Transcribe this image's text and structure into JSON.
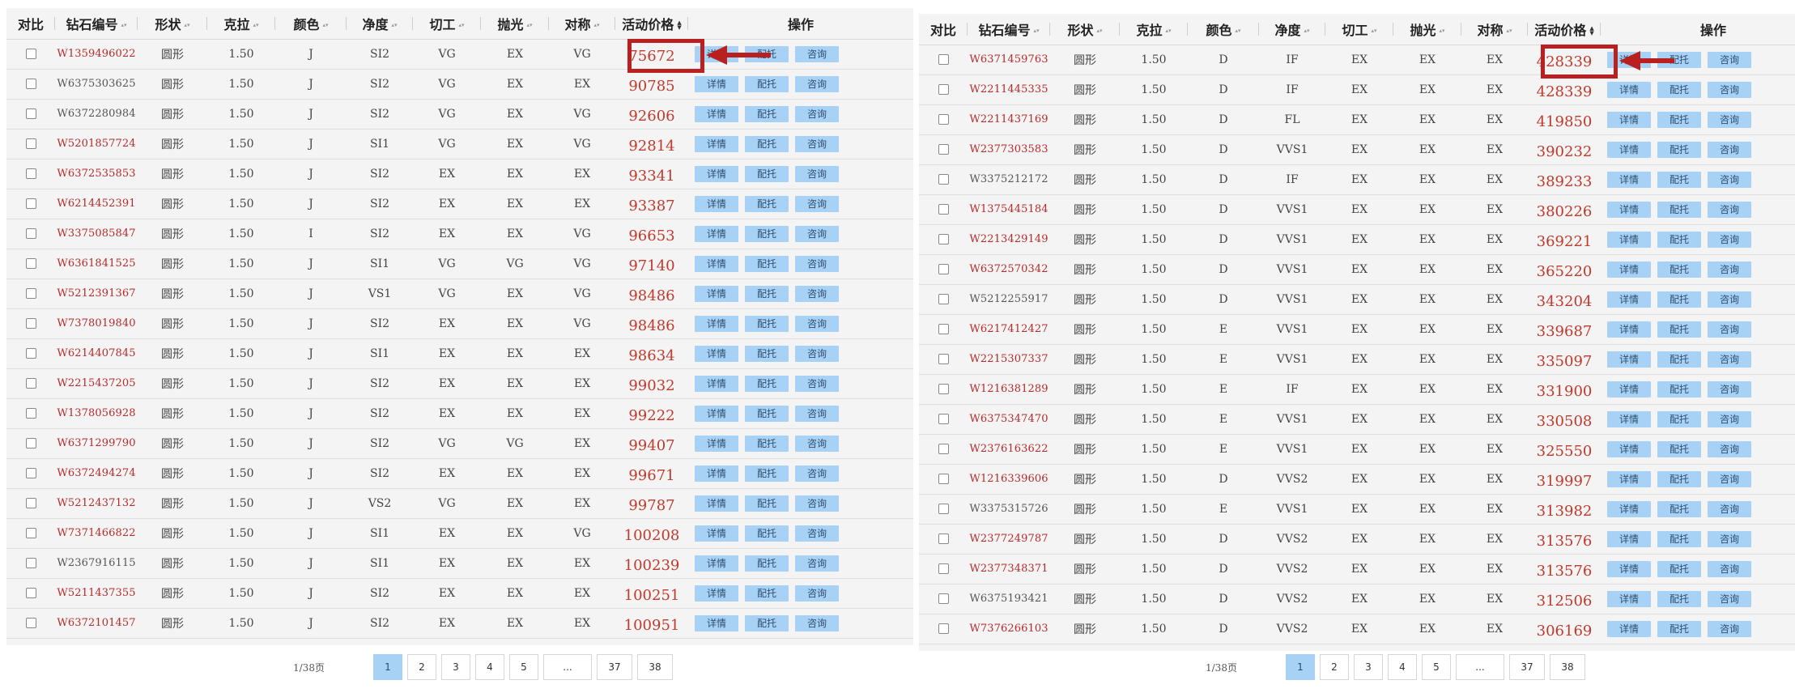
{
  "colors": {
    "price": "#c0392b",
    "id_red": "#b52a2a",
    "button_bg": "#a7d1f5",
    "highlight": "#b8211f"
  },
  "table": {
    "headers": {
      "compare": "对比",
      "id": "钻石编号",
      "shape": "形状",
      "carat": "克拉",
      "color": "颜色",
      "clarity": "净度",
      "cut": "切工",
      "polish": "抛光",
      "symmetry": "对称",
      "price": "活动价格",
      "ops": "操作"
    },
    "buttons": {
      "details": "详情",
      "setting": "配托",
      "consult": "咨询"
    }
  },
  "left": {
    "rows": [
      {
        "id": "W1359496022",
        "red": true,
        "shape": "圆形",
        "carat": "1.50",
        "color": "J",
        "clarity": "SI2",
        "cut": "VG",
        "polish": "EX",
        "sym": "VG",
        "price": "75672"
      },
      {
        "id": "W6375303625",
        "red": false,
        "shape": "圆形",
        "carat": "1.50",
        "color": "J",
        "clarity": "SI2",
        "cut": "VG",
        "polish": "EX",
        "sym": "EX",
        "price": "90785"
      },
      {
        "id": "W6372280984",
        "red": false,
        "shape": "圆形",
        "carat": "1.50",
        "color": "J",
        "clarity": "SI2",
        "cut": "VG",
        "polish": "EX",
        "sym": "VG",
        "price": "92606"
      },
      {
        "id": "W5201857724",
        "red": true,
        "shape": "圆形",
        "carat": "1.50",
        "color": "J",
        "clarity": "SI1",
        "cut": "VG",
        "polish": "EX",
        "sym": "VG",
        "price": "92814"
      },
      {
        "id": "W6372535853",
        "red": true,
        "shape": "圆形",
        "carat": "1.50",
        "color": "J",
        "clarity": "SI2",
        "cut": "EX",
        "polish": "EX",
        "sym": "EX",
        "price": "93341"
      },
      {
        "id": "W6214452391",
        "red": true,
        "shape": "圆形",
        "carat": "1.50",
        "color": "J",
        "clarity": "SI2",
        "cut": "EX",
        "polish": "EX",
        "sym": "EX",
        "price": "93387"
      },
      {
        "id": "W3375085847",
        "red": true,
        "shape": "圆形",
        "carat": "1.50",
        "color": "I",
        "clarity": "SI2",
        "cut": "EX",
        "polish": "EX",
        "sym": "VG",
        "price": "96653"
      },
      {
        "id": "W6361841525",
        "red": true,
        "shape": "圆形",
        "carat": "1.50",
        "color": "J",
        "clarity": "SI1",
        "cut": "VG",
        "polish": "VG",
        "sym": "VG",
        "price": "97140"
      },
      {
        "id": "W5212391367",
        "red": true,
        "shape": "圆形",
        "carat": "1.50",
        "color": "J",
        "clarity": "VS1",
        "cut": "VG",
        "polish": "EX",
        "sym": "VG",
        "price": "98486"
      },
      {
        "id": "W7378019840",
        "red": true,
        "shape": "圆形",
        "carat": "1.50",
        "color": "J",
        "clarity": "SI2",
        "cut": "EX",
        "polish": "EX",
        "sym": "VG",
        "price": "98486"
      },
      {
        "id": "W6214407845",
        "red": true,
        "shape": "圆形",
        "carat": "1.50",
        "color": "J",
        "clarity": "SI1",
        "cut": "EX",
        "polish": "EX",
        "sym": "EX",
        "price": "98634"
      },
      {
        "id": "W2215437205",
        "red": true,
        "shape": "圆形",
        "carat": "1.50",
        "color": "J",
        "clarity": "SI2",
        "cut": "EX",
        "polish": "EX",
        "sym": "EX",
        "price": "99032"
      },
      {
        "id": "W1378056928",
        "red": true,
        "shape": "圆形",
        "carat": "1.50",
        "color": "J",
        "clarity": "SI2",
        "cut": "EX",
        "polish": "EX",
        "sym": "EX",
        "price": "99222"
      },
      {
        "id": "W6371299790",
        "red": true,
        "shape": "圆形",
        "carat": "1.50",
        "color": "J",
        "clarity": "SI2",
        "cut": "VG",
        "polish": "VG",
        "sym": "EX",
        "price": "99407"
      },
      {
        "id": "W6372494274",
        "red": true,
        "shape": "圆形",
        "carat": "1.50",
        "color": "J",
        "clarity": "SI2",
        "cut": "EX",
        "polish": "EX",
        "sym": "EX",
        "price": "99671"
      },
      {
        "id": "W5212437132",
        "red": true,
        "shape": "圆形",
        "carat": "1.50",
        "color": "J",
        "clarity": "VS2",
        "cut": "VG",
        "polish": "EX",
        "sym": "EX",
        "price": "99787"
      },
      {
        "id": "W7371466822",
        "red": true,
        "shape": "圆形",
        "carat": "1.50",
        "color": "J",
        "clarity": "SI1",
        "cut": "EX",
        "polish": "EX",
        "sym": "VG",
        "price": "100208"
      },
      {
        "id": "W2367916115",
        "red": false,
        "shape": "圆形",
        "carat": "1.50",
        "color": "J",
        "clarity": "SI1",
        "cut": "EX",
        "polish": "EX",
        "sym": "EX",
        "price": "100239"
      },
      {
        "id": "W5211437355",
        "red": true,
        "shape": "圆形",
        "carat": "1.50",
        "color": "J",
        "clarity": "SI2",
        "cut": "EX",
        "polish": "EX",
        "sym": "EX",
        "price": "100251"
      },
      {
        "id": "W6372101457",
        "red": true,
        "shape": "圆形",
        "carat": "1.50",
        "color": "J",
        "clarity": "SI2",
        "cut": "EX",
        "polish": "EX",
        "sym": "EX",
        "price": "100951"
      }
    ],
    "pager": {
      "info": "1/38页",
      "pages": [
        "1",
        "2",
        "3",
        "4",
        "5",
        "...",
        "37",
        "38"
      ]
    }
  },
  "right": {
    "rows": [
      {
        "id": "W6371459763",
        "red": true,
        "shape": "圆形",
        "carat": "1.50",
        "color": "D",
        "clarity": "IF",
        "cut": "EX",
        "polish": "EX",
        "sym": "EX",
        "price": "428339"
      },
      {
        "id": "W2211445335",
        "red": true,
        "shape": "圆形",
        "carat": "1.50",
        "color": "D",
        "clarity": "IF",
        "cut": "EX",
        "polish": "EX",
        "sym": "EX",
        "price": "428339"
      },
      {
        "id": "W2211437169",
        "red": true,
        "shape": "圆形",
        "carat": "1.50",
        "color": "D",
        "clarity": "FL",
        "cut": "EX",
        "polish": "EX",
        "sym": "EX",
        "price": "419850"
      },
      {
        "id": "W2377303583",
        "red": true,
        "shape": "圆形",
        "carat": "1.50",
        "color": "D",
        "clarity": "VVS1",
        "cut": "EX",
        "polish": "EX",
        "sym": "EX",
        "price": "390232"
      },
      {
        "id": "W3375212172",
        "red": false,
        "shape": "圆形",
        "carat": "1.50",
        "color": "D",
        "clarity": "IF",
        "cut": "EX",
        "polish": "EX",
        "sym": "EX",
        "price": "389233"
      },
      {
        "id": "W1375445184",
        "red": true,
        "shape": "圆形",
        "carat": "1.50",
        "color": "D",
        "clarity": "VVS1",
        "cut": "EX",
        "polish": "EX",
        "sym": "EX",
        "price": "380226"
      },
      {
        "id": "W2213429149",
        "red": true,
        "shape": "圆形",
        "carat": "1.50",
        "color": "D",
        "clarity": "VVS1",
        "cut": "EX",
        "polish": "EX",
        "sym": "EX",
        "price": "369221"
      },
      {
        "id": "W6372570342",
        "red": true,
        "shape": "圆形",
        "carat": "1.50",
        "color": "D",
        "clarity": "VVS1",
        "cut": "EX",
        "polish": "EX",
        "sym": "EX",
        "price": "365220"
      },
      {
        "id": "W5212255917",
        "red": false,
        "shape": "圆形",
        "carat": "1.50",
        "color": "D",
        "clarity": "VVS1",
        "cut": "EX",
        "polish": "EX",
        "sym": "EX",
        "price": "343204"
      },
      {
        "id": "W6217412427",
        "red": true,
        "shape": "圆形",
        "carat": "1.50",
        "color": "E",
        "clarity": "VVS1",
        "cut": "EX",
        "polish": "EX",
        "sym": "EX",
        "price": "339687"
      },
      {
        "id": "W2215307337",
        "red": true,
        "shape": "圆形",
        "carat": "1.50",
        "color": "E",
        "clarity": "VVS1",
        "cut": "EX",
        "polish": "EX",
        "sym": "EX",
        "price": "335097"
      },
      {
        "id": "W1216381289",
        "red": true,
        "shape": "圆形",
        "carat": "1.50",
        "color": "E",
        "clarity": "IF",
        "cut": "EX",
        "polish": "EX",
        "sym": "EX",
        "price": "331900"
      },
      {
        "id": "W6375347470",
        "red": true,
        "shape": "圆形",
        "carat": "1.50",
        "color": "E",
        "clarity": "VVS1",
        "cut": "EX",
        "polish": "EX",
        "sym": "EX",
        "price": "330508"
      },
      {
        "id": "W2376163622",
        "red": true,
        "shape": "圆形",
        "carat": "1.50",
        "color": "E",
        "clarity": "VVS1",
        "cut": "EX",
        "polish": "EX",
        "sym": "EX",
        "price": "325550"
      },
      {
        "id": "W1216339606",
        "red": true,
        "shape": "圆形",
        "carat": "1.50",
        "color": "D",
        "clarity": "VVS2",
        "cut": "EX",
        "polish": "EX",
        "sym": "EX",
        "price": "319997"
      },
      {
        "id": "W3375315726",
        "red": false,
        "shape": "圆形",
        "carat": "1.50",
        "color": "E",
        "clarity": "VVS1",
        "cut": "EX",
        "polish": "EX",
        "sym": "EX",
        "price": "313982"
      },
      {
        "id": "W2377249787",
        "red": true,
        "shape": "圆形",
        "carat": "1.50",
        "color": "D",
        "clarity": "VVS2",
        "cut": "EX",
        "polish": "EX",
        "sym": "EX",
        "price": "313576"
      },
      {
        "id": "W2377348371",
        "red": true,
        "shape": "圆形",
        "carat": "1.50",
        "color": "D",
        "clarity": "VVS2",
        "cut": "EX",
        "polish": "EX",
        "sym": "EX",
        "price": "313576"
      },
      {
        "id": "W6375193421",
        "red": false,
        "shape": "圆形",
        "carat": "1.50",
        "color": "D",
        "clarity": "VVS2",
        "cut": "EX",
        "polish": "EX",
        "sym": "EX",
        "price": "312506"
      },
      {
        "id": "W7376266103",
        "red": true,
        "shape": "圆形",
        "carat": "1.50",
        "color": "D",
        "clarity": "VVS2",
        "cut": "EX",
        "polish": "EX",
        "sym": "EX",
        "price": "306169"
      }
    ],
    "pager": {
      "info": "1/38页",
      "pages": [
        "1",
        "2",
        "3",
        "4",
        "5",
        "...",
        "37",
        "38"
      ]
    }
  }
}
